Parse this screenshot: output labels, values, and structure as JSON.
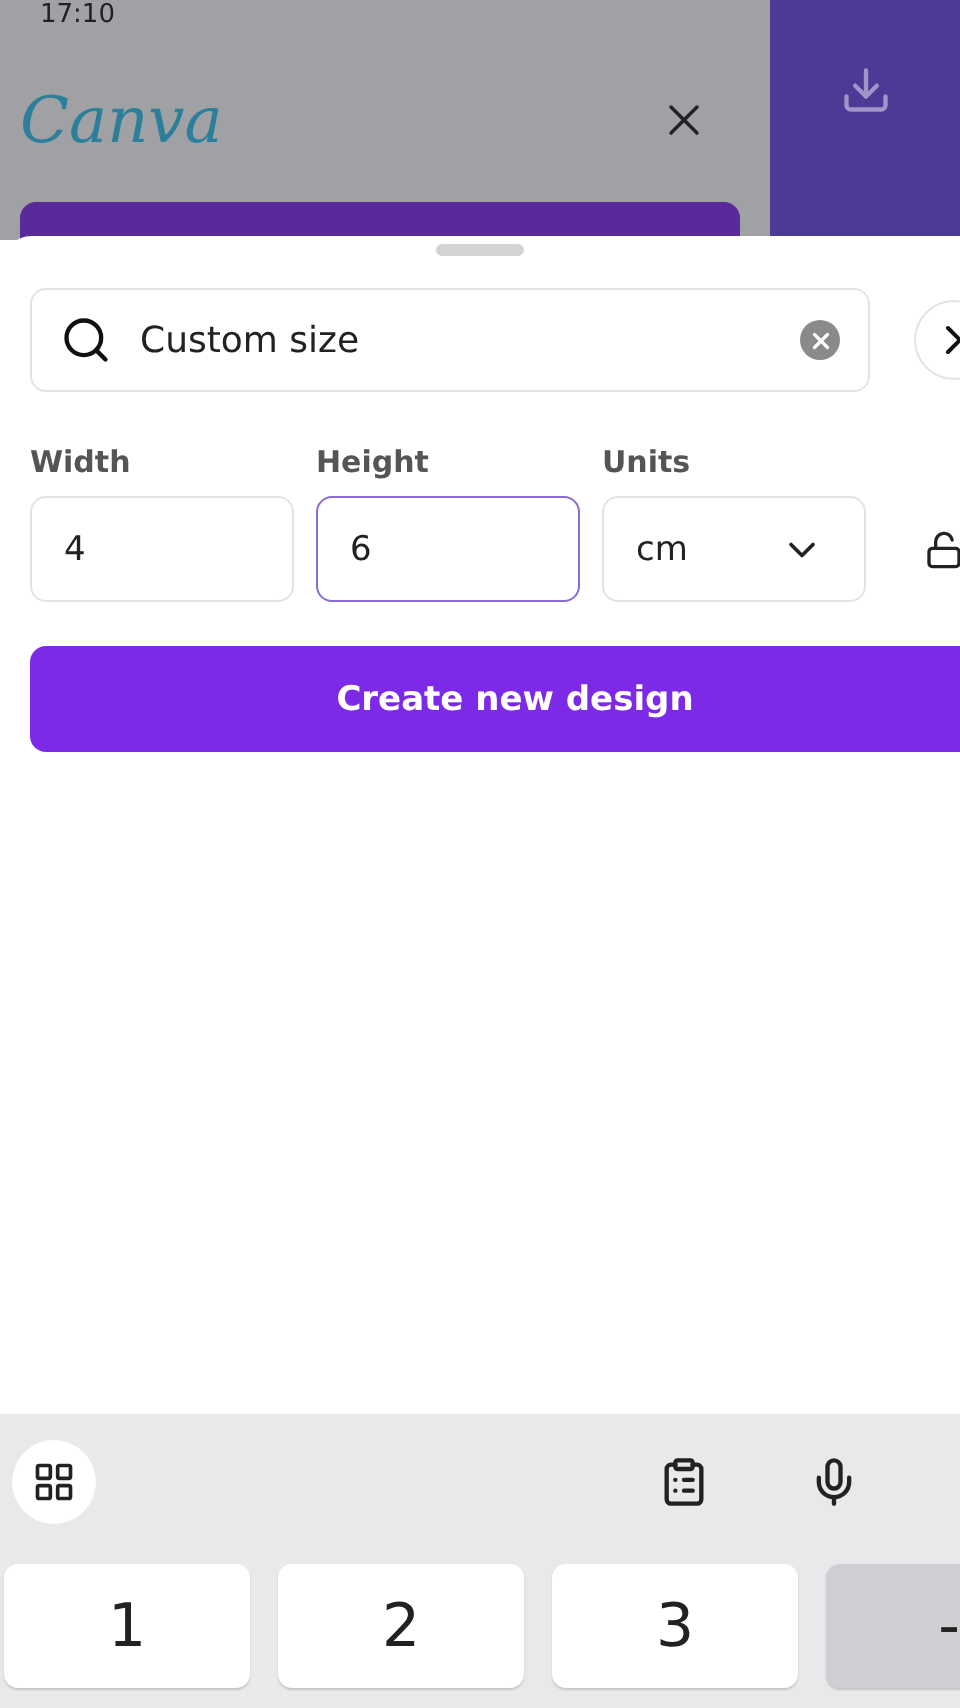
{
  "status_bar": {
    "time": "17:10"
  },
  "header": {
    "logo": "Canva"
  },
  "search": {
    "value": "Custom size"
  },
  "size_fields": [
    {
      "label": "Width",
      "value": "4",
      "focused": false
    },
    {
      "label": "Height",
      "value": "6",
      "focused": true
    }
  ],
  "units": {
    "label": "Units",
    "value": "cm"
  },
  "create_button": "Create new design",
  "keyboard": {
    "keys": [
      "1",
      "2",
      "3",
      "-"
    ]
  }
}
